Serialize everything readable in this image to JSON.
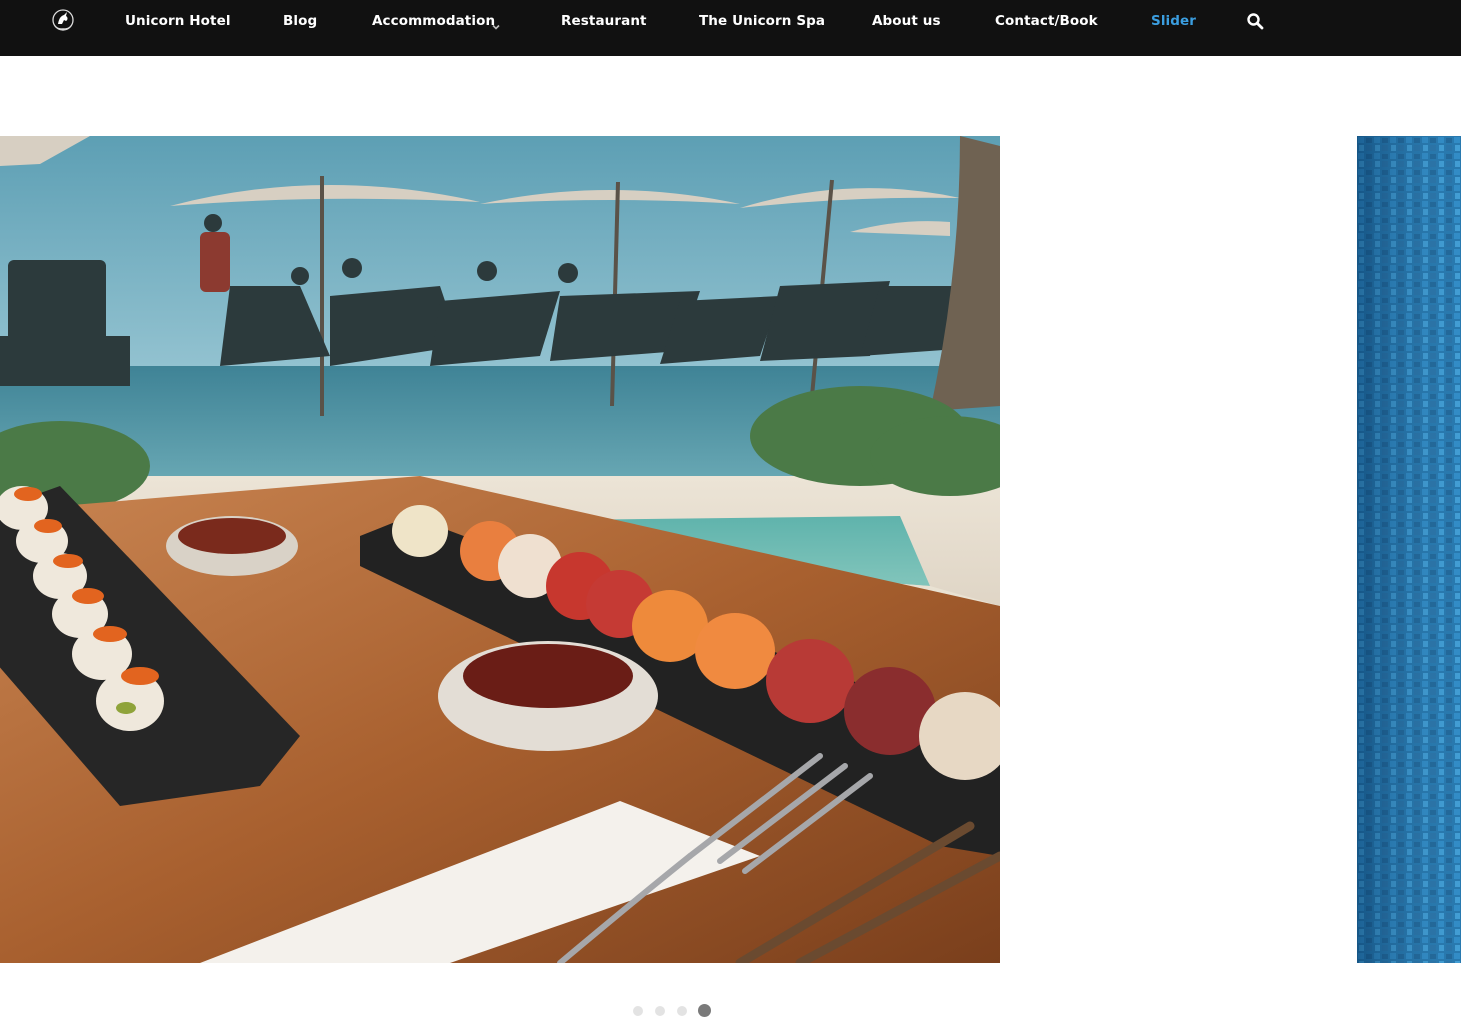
{
  "nav": {
    "items": [
      {
        "label": "Unicorn Hotel"
      },
      {
        "label": "Blog"
      },
      {
        "label": "Accommodation",
        "has_dropdown": true
      },
      {
        "label": "Restaurant"
      },
      {
        "label": "The Unicorn Spa"
      },
      {
        "label": "About us"
      },
      {
        "label": "Contact/Book"
      },
      {
        "label": "Slider",
        "active": true
      }
    ],
    "logo_icon": "unicorn-crest-icon",
    "search_icon": "search-icon"
  },
  "slider": {
    "slide_count": 4,
    "active_slide": 4
  },
  "colors": {
    "nav_background": "#111111",
    "nav_text": "#ffffff",
    "nav_active": "#3b9ee0",
    "dot_inactive": "#e3e3e3",
    "dot_active": "#7a7a7a"
  }
}
